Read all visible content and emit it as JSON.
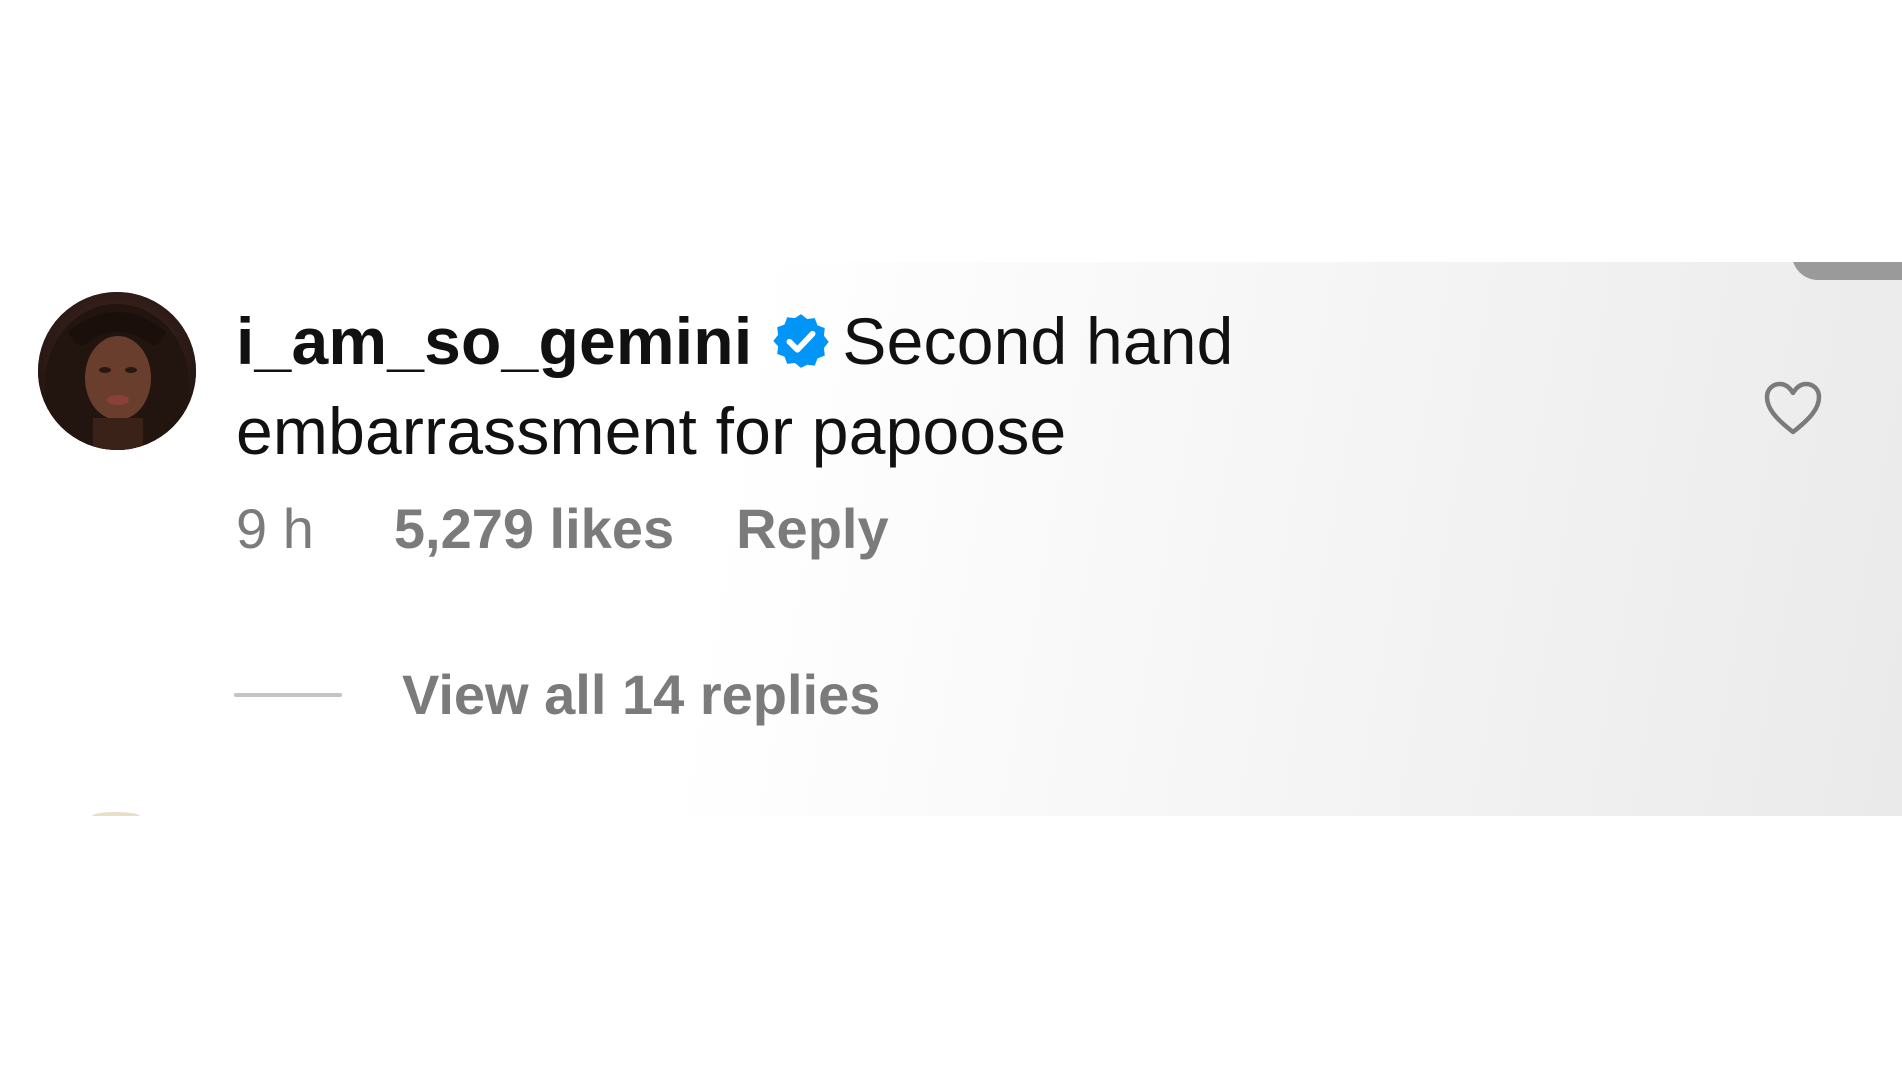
{
  "comment": {
    "username": "i_am_so_gemini",
    "verified": true,
    "text": "Second hand embarrassment for papoose",
    "time": "9 h",
    "likes": "5,279 likes",
    "reply_label": "Reply",
    "view_replies_label": "View all 14 replies"
  },
  "icons": {
    "verified_badge": "verified-badge-icon",
    "like": "heart-outline-icon"
  },
  "colors": {
    "verified_blue": "#0095f6",
    "meta_gray": "#7b7b7b",
    "text_black": "#111111"
  }
}
